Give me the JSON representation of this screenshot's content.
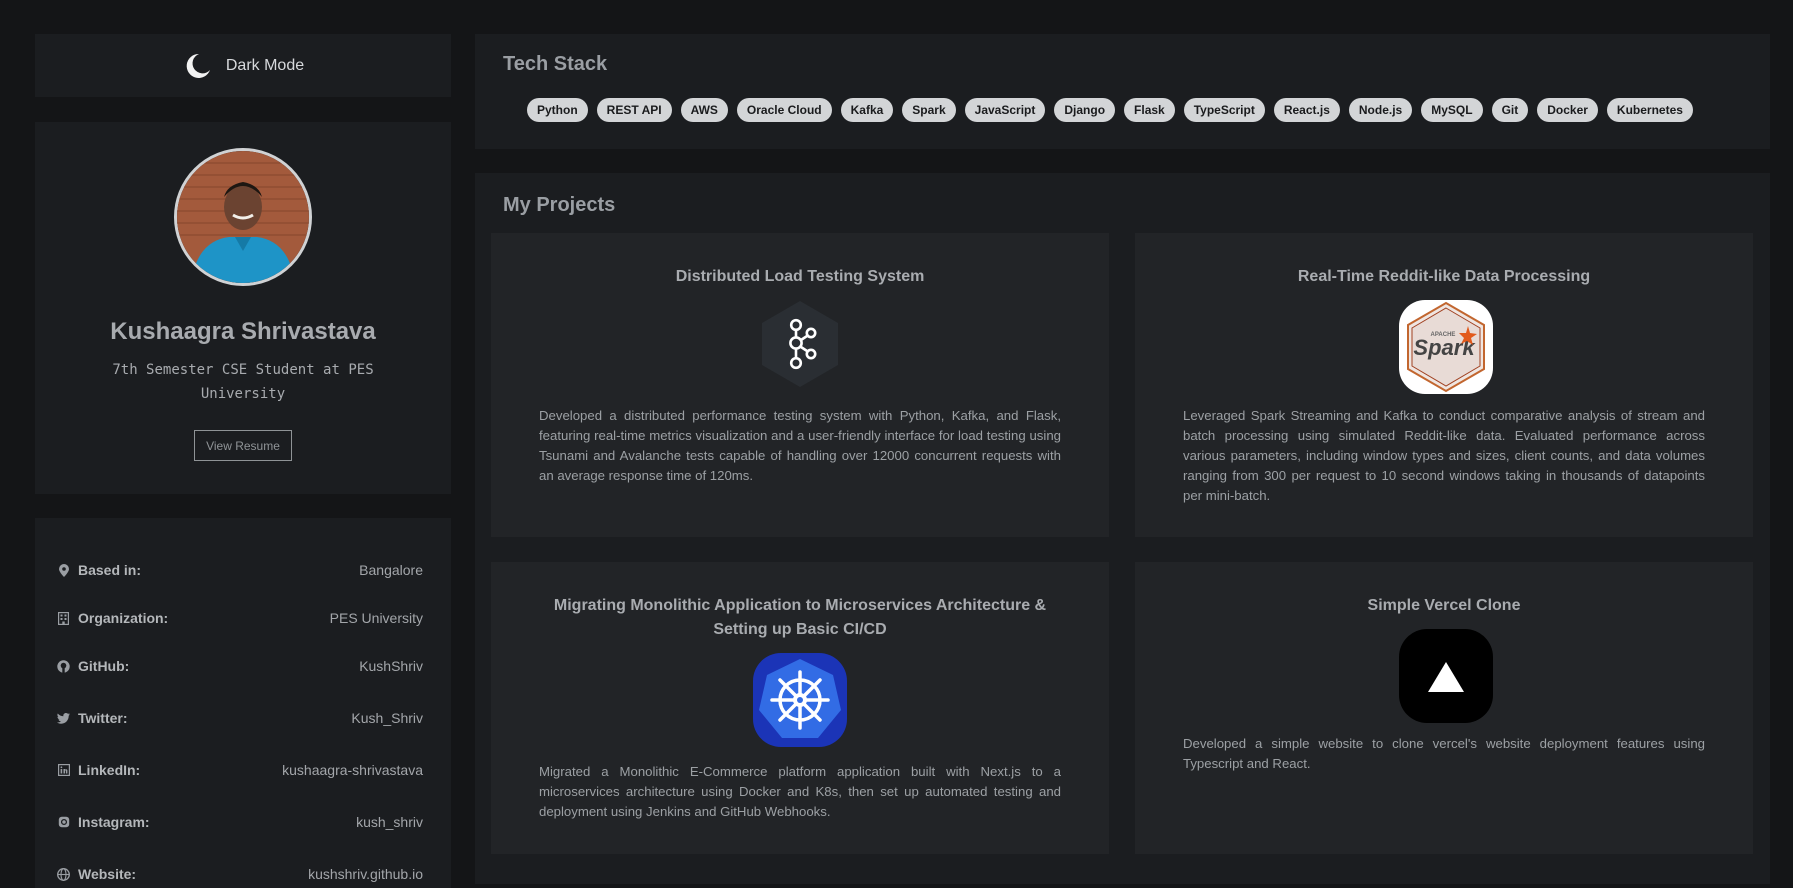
{
  "theme_toggle": {
    "label": "Dark Mode",
    "icon": "moon-icon"
  },
  "profile": {
    "name": "Kushaagra Shrivastava",
    "subtitle": "7th Semester CSE Student at PES University",
    "resume_label": "View Resume"
  },
  "info": [
    {
      "icon": "map-pin-icon",
      "key": "Based in:",
      "value": "Bangalore"
    },
    {
      "icon": "building-icon",
      "key": "Organization:",
      "value": "PES University"
    },
    {
      "icon": "github-icon",
      "key": "GitHub:",
      "value": "KushShriv"
    },
    {
      "icon": "twitter-icon",
      "key": "Twitter:",
      "value": "Kush_Shriv"
    },
    {
      "icon": "linkedin-icon",
      "key": "LinkedIn:",
      "value": "kushaagra-shrivastava"
    },
    {
      "icon": "instagram-icon",
      "key": "Instagram:",
      "value": "kush_shriv"
    },
    {
      "icon": "globe-icon",
      "key": "Website:",
      "value": "kushshriv.github.io"
    }
  ],
  "tech_stack": {
    "title": "Tech Stack",
    "tags": [
      "Python",
      "REST API",
      "AWS",
      "Oracle Cloud",
      "Kafka",
      "Spark",
      "JavaScript",
      "Django",
      "Flask",
      "TypeScript",
      "React.js",
      "Node.js",
      "MySQL",
      "Git",
      "Docker",
      "Kubernetes"
    ]
  },
  "projects": {
    "title": "My Projects",
    "items": [
      {
        "title": "Distributed Load Testing System",
        "logo": "kafka-logo",
        "description": "Developed a distributed performance testing system with Python, Kafka, and Flask, featuring real-time metrics visualization and a user-friendly interface for load testing using Tsunami and Avalanche tests capable of handling over 12000 concurrent requests with an average response time of 120ms."
      },
      {
        "title": "Real-Time Reddit-like Data Processing",
        "logo": "spark-logo",
        "logo_text": "Spark",
        "logo_subtext": "APACHE",
        "description": "Leveraged Spark Streaming and Kafka to conduct comparative analysis of stream and batch processing using simulated Reddit-like data. Evaluated performance across various parameters, including window types and sizes, client counts, and data volumes ranging from 300 per request to 10 second windows taking in thousands of datapoints per mini-batch."
      },
      {
        "title": "Migrating Monolithic Application to Microservices Architecture & Setting up Basic CI/CD",
        "logo": "kubernetes-logo",
        "description": "Migrated a Monolithic E-Commerce platform application built with Next.js to a microservices architecture using Docker and K8s, then set up automated testing and deployment using Jenkins and GitHub Webhooks."
      },
      {
        "title": "Simple Vercel Clone",
        "logo": "vercel-logo",
        "description": "Developed a simple website to clone vercel's website deployment features using Typescript and React."
      }
    ]
  },
  "colors": {
    "page_bg": "#141517",
    "panel_bg": "#1b1d20",
    "card_bg": "#222427",
    "tag_bg": "#d3d5d7",
    "kubernetes_blue": "#326ce5",
    "spark_orange": "#e25a1c"
  }
}
